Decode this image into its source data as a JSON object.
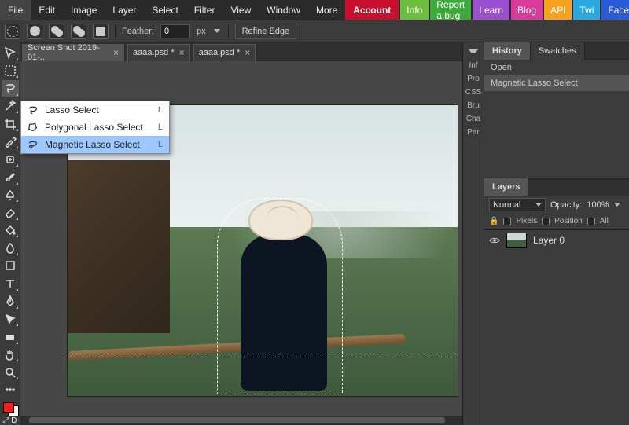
{
  "menubar": {
    "items": [
      "File",
      "Edit",
      "Image",
      "Layer",
      "Select",
      "Filter",
      "View",
      "Window",
      "More"
    ],
    "account": "Account",
    "pills": [
      {
        "cls": "info",
        "label": "Info"
      },
      {
        "cls": "bug",
        "label": "Report a bug"
      },
      {
        "cls": "learn",
        "label": "Learn"
      },
      {
        "cls": "blog",
        "label": "Blog"
      },
      {
        "cls": "api",
        "label": "API"
      },
      {
        "cls": "twi",
        "label": "Twi"
      },
      {
        "cls": "fb",
        "label": "Facebook"
      }
    ]
  },
  "optbar": {
    "feather_label": "Feather:",
    "feather_value": "0",
    "feather_unit": "px",
    "refine": "Refine Edge"
  },
  "tabs": [
    {
      "label": "Screen Shot 2019-01-..",
      "active": true
    },
    {
      "label": "aaaa.psd *",
      "active": false
    },
    {
      "label": "aaaa.psd *",
      "active": false
    }
  ],
  "flyout": {
    "items": [
      {
        "icon": "lasso",
        "label": "Lasso Select",
        "key": "L",
        "hover": false
      },
      {
        "icon": "poly-lasso",
        "label": "Polygonal Lasso Select",
        "key": "L",
        "hover": false
      },
      {
        "icon": "mag-lasso",
        "label": "Magnetic Lasso Select",
        "key": "L",
        "hover": true
      }
    ]
  },
  "midstrip": [
    "Inf",
    "Pro",
    "CSS",
    "Bru",
    "Cha",
    "Par"
  ],
  "history": {
    "tabs": [
      "History",
      "Swatches"
    ],
    "active": 0,
    "items": [
      "Open",
      "Magnetic Lasso Select"
    ],
    "current": 1
  },
  "layers": {
    "tab": "Layers",
    "blend": "Normal",
    "opacity_label": "Opacity:",
    "opacity": "100%",
    "locks": {
      "pixels": "Pixels",
      "position": "Position",
      "all": "All"
    },
    "items": [
      {
        "name": "Layer 0",
        "visible": true
      }
    ]
  },
  "swatch_reset": "D"
}
